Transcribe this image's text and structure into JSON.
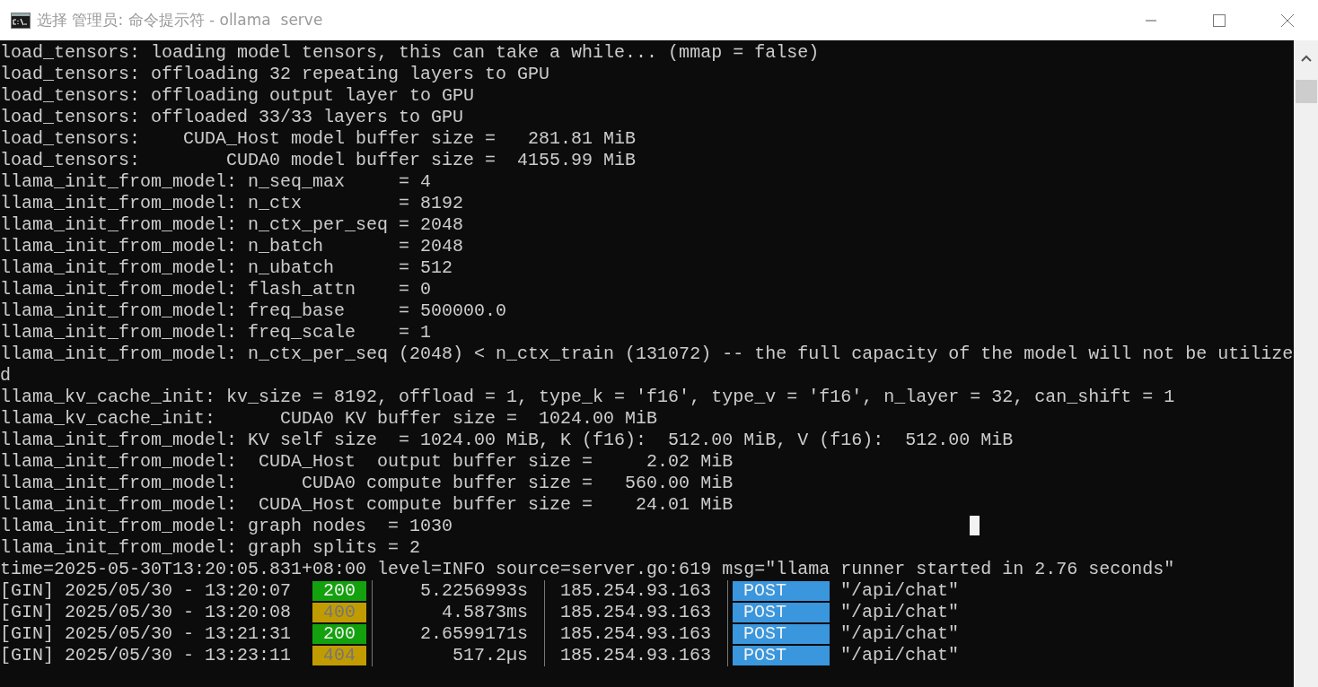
{
  "window": {
    "title": "选择 管理员: 命令提示符 - ollama  serve"
  },
  "terminal": {
    "lines": [
      "load_tensors: loading model tensors, this can take a while... (mmap = false)",
      "load_tensors: offloading 32 repeating layers to GPU",
      "load_tensors: offloading output layer to GPU",
      "load_tensors: offloaded 33/33 layers to GPU",
      "load_tensors:    CUDA_Host model buffer size =   281.81 MiB",
      "load_tensors:        CUDA0 model buffer size =  4155.99 MiB",
      "llama_init_from_model: n_seq_max     = 4",
      "llama_init_from_model: n_ctx         = 8192",
      "llama_init_from_model: n_ctx_per_seq = 2048",
      "llama_init_from_model: n_batch       = 2048",
      "llama_init_from_model: n_ubatch      = 512",
      "llama_init_from_model: flash_attn    = 0",
      "llama_init_from_model: freq_base     = 500000.0",
      "llama_init_from_model: freq_scale    = 1",
      "llama_init_from_model: n_ctx_per_seq (2048) < n_ctx_train (131072) -- the full capacity of the model will not be utilize",
      "d",
      "llama_kv_cache_init: kv_size = 8192, offload = 1, type_k = 'f16', type_v = 'f16', n_layer = 32, can_shift = 1",
      "llama_kv_cache_init:      CUDA0 KV buffer size =  1024.00 MiB",
      "llama_init_from_model: KV self size  = 1024.00 MiB, K (f16):  512.00 MiB, V (f16):  512.00 MiB",
      "llama_init_from_model:  CUDA_Host  output buffer size =     2.02 MiB",
      "llama_init_from_model:      CUDA0 compute buffer size =   560.00 MiB",
      "llama_init_from_model:  CUDA_Host compute buffer size =    24.01 MiB",
      "llama_init_from_model: graph nodes  = 1030",
      "llama_init_from_model: graph splits = 2",
      "time=2025-05-30T13:20:05.831+08:00 level=INFO source=server.go:619 msg=\"llama runner started in 2.76 seconds\""
    ],
    "gin_log": [
      {
        "prefix": "[GIN] 2025/05/30 - 13:20:07",
        "status": "200",
        "kind": "success",
        "color": "#13a10e",
        "duration": "5.2256993s",
        "ip": "185.254.93.163",
        "method": "POST",
        "path": "\"/api/chat\""
      },
      {
        "prefix": "[GIN] 2025/05/30 - 13:20:08",
        "status": "400",
        "kind": "client_error",
        "color": "#c19c00",
        "duration": "4.5873ms",
        "ip": "185.254.93.163",
        "method": "POST",
        "path": "\"/api/chat\""
      },
      {
        "prefix": "[GIN] 2025/05/30 - 13:21:31",
        "status": "200",
        "kind": "success",
        "color": "#13a10e",
        "duration": "2.6599171s",
        "ip": "185.254.93.163",
        "method": "POST",
        "path": "\"/api/chat\""
      },
      {
        "prefix": "[GIN] 2025/05/30 - 13:23:11",
        "status": "404",
        "kind": "client_error",
        "color": "#c19c00",
        "duration": "517.2µs",
        "ip": "185.254.93.163",
        "method": "POST",
        "path": "\"/api/chat\""
      }
    ]
  }
}
